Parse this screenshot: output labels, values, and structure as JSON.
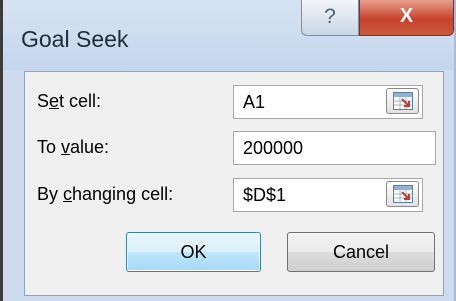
{
  "dialog": {
    "title": "Goal Seek",
    "help_glyph": "?",
    "close_glyph": "X"
  },
  "fields": [
    {
      "label_before": "S",
      "label_mnemonic": "e",
      "label_after": "t cell:",
      "value": "A1",
      "ref_icon": "range-select-icon"
    },
    {
      "label_before": "To ",
      "label_mnemonic": "v",
      "label_after": "alue:",
      "value": "200000"
    },
    {
      "label_before": "By ",
      "label_mnemonic": "c",
      "label_after": "hanging cell:",
      "value": "$D$1",
      "ref_icon": "range-select-icon"
    }
  ],
  "buttons": {
    "ok": "OK",
    "cancel": "Cancel"
  },
  "colors": {
    "title_bar": "#cfdcef",
    "close_button": "#c7422b",
    "ok_button_border": "#3c7fb1"
  }
}
